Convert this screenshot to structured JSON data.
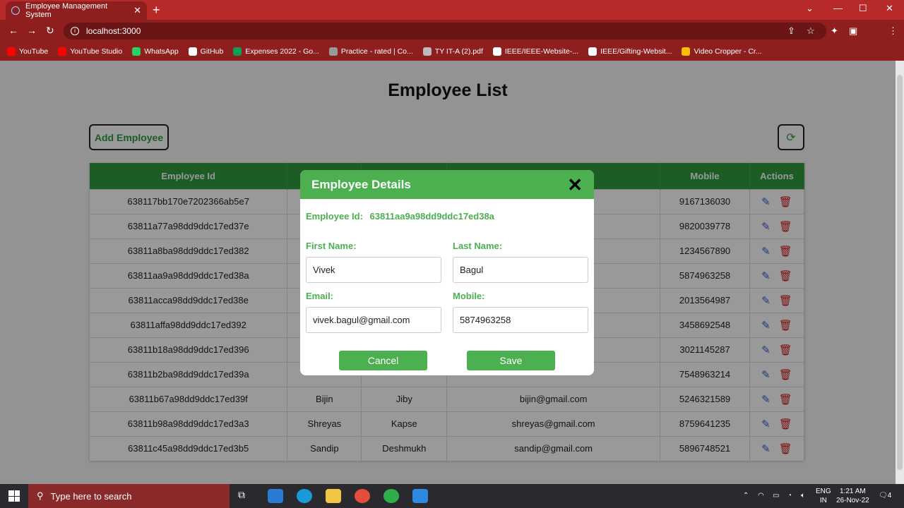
{
  "browser": {
    "tab_title": "Employee Management System",
    "url": "localhost:3000",
    "bookmarks": [
      {
        "label": "YouTube",
        "color": "#ff0000"
      },
      {
        "label": "YouTube Studio",
        "color": "#ff0000"
      },
      {
        "label": "WhatsApp",
        "color": "#25d366"
      },
      {
        "label": "GitHub",
        "color": "#ffffff"
      },
      {
        "label": "Expenses 2022 - Go...",
        "color": "#0f9d58"
      },
      {
        "label": "Practice - rated | Co...",
        "color": "#999999"
      },
      {
        "label": "TY IT-A (2).pdf",
        "color": "#bbbbbb"
      },
      {
        "label": "IEEE/IEEE-Website-...",
        "color": "#ffffff"
      },
      {
        "label": "IEEE/Gifting-Websit...",
        "color": "#ffffff"
      },
      {
        "label": "Video Cropper - Cr...",
        "color": "#fbbc05"
      }
    ]
  },
  "page": {
    "title": "Employee List",
    "add_button": "Add Employee",
    "columns": [
      "Employee Id",
      "",
      "",
      "",
      "Mobile",
      "Actions"
    ],
    "rows": [
      {
        "id": "638117bb170e7202366ab5e7",
        "first": "",
        "last": "",
        "email": "il.com",
        "mobile": "9167136030"
      },
      {
        "id": "63811a77a98dd9ddc17ed37e",
        "first": "",
        "last": "",
        "email": ".com",
        "mobile": "9820039778"
      },
      {
        "id": "63811a8ba98dd9ddc17ed382",
        "first": "",
        "last": "",
        "email": "",
        "mobile": "1234567890"
      },
      {
        "id": "63811aa9a98dd9ddc17ed38a",
        "first": "",
        "last": "",
        "email": "m",
        "mobile": "5874963258"
      },
      {
        "id": "63811acca98dd9ddc17ed38e",
        "first": "",
        "last": "",
        "email": "m",
        "mobile": "2013564987"
      },
      {
        "id": "63811affa98dd9ddc17ed392",
        "first": "",
        "last": "",
        "email": "com",
        "mobile": "3458692548"
      },
      {
        "id": "63811b18a98dd9ddc17ed396",
        "first": "",
        "last": "",
        "email": "om",
        "mobile": "3021145287"
      },
      {
        "id": "63811b2ba98dd9ddc17ed39a",
        "first": "",
        "last": "",
        "email": "",
        "mobile": "7548963214"
      },
      {
        "id": "63811b67a98dd9ddc17ed39f",
        "first": "Bijin",
        "last": "Jiby",
        "email": "bijin@gmail.com",
        "mobile": "5246321589"
      },
      {
        "id": "63811b98a98dd9ddc17ed3a3",
        "first": "Shreyas",
        "last": "Kapse",
        "email": "shreyas@gmail.com",
        "mobile": "8759641235"
      },
      {
        "id": "63811c45a98dd9ddc17ed3b5",
        "first": "Sandip",
        "last": "Deshmukh",
        "email": "sandip@gmail.com",
        "mobile": "5896748521"
      }
    ]
  },
  "modal": {
    "title": "Employee Details",
    "id_label": "Employee Id:",
    "id_value": "63811aa9a98dd9ddc17ed38a",
    "first_label": "First Name:",
    "first_value": "Vivek",
    "last_label": "Last Name:",
    "last_value": "Bagul",
    "email_label": "Email:",
    "email_value": "vivek.bagul@gmail.com",
    "mobile_label": "Mobile:",
    "mobile_value": "5874963258",
    "cancel": "Cancel",
    "save": "Save"
  },
  "taskbar": {
    "search_placeholder": "Type here to search",
    "lang_top": "ENG",
    "lang_bottom": "IN",
    "time": "1:21 AM",
    "date": "26-Nov-22",
    "notif_count": "4"
  }
}
